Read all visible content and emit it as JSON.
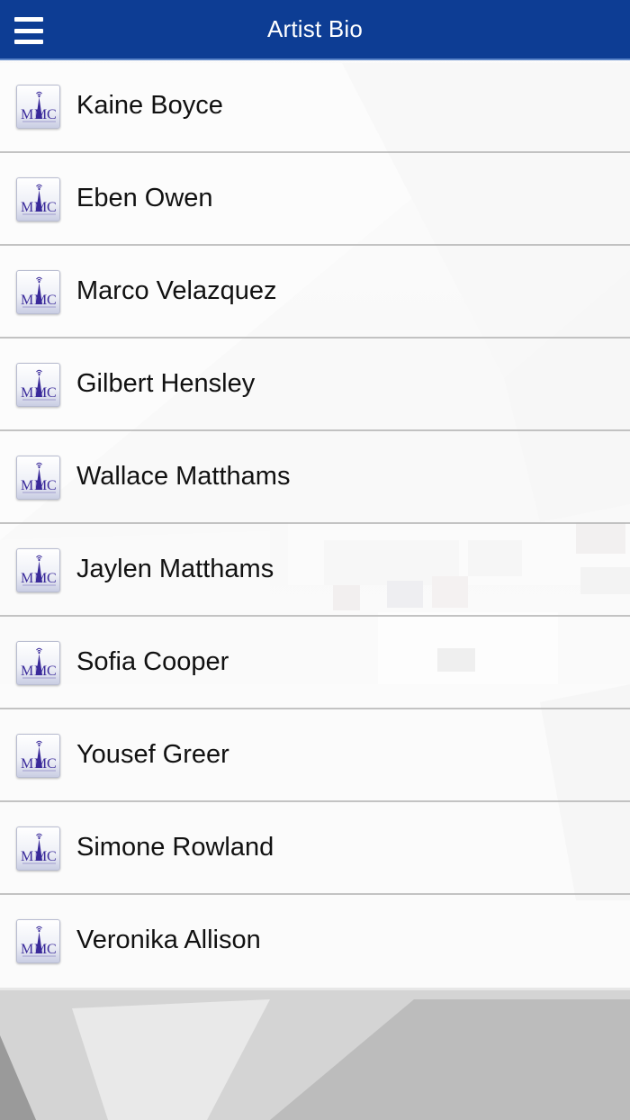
{
  "header": {
    "title": "Artist Bio",
    "menu_icon": "hamburger-menu-icon",
    "background_color": "#0d3d94"
  },
  "artists": [
    {
      "name": "Kaine Boyce"
    },
    {
      "name": "Eben Owen"
    },
    {
      "name": "Marco Velazquez"
    },
    {
      "name": "Gilbert Hensley"
    },
    {
      "name": "Wallace Matthams"
    },
    {
      "name": "Jaylen Matthams"
    },
    {
      "name": "Sofia Cooper"
    },
    {
      "name": "Yousef Greer"
    },
    {
      "name": "Simone Rowland"
    },
    {
      "name": "Veronika Allison"
    }
  ],
  "logo": {
    "text": "MMC",
    "icon": "mmc-logo-icon",
    "color": "#3a2a9a"
  }
}
